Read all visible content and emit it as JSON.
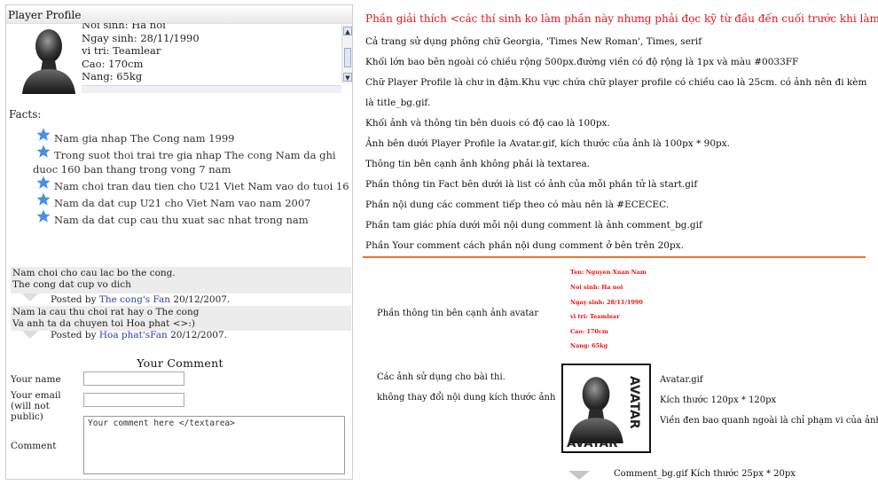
{
  "profile": {
    "title": "Player Profile",
    "info_lines": [
      "Noi sinh: Ha noi",
      "Ngay sinh: 28/11/1990",
      "vi tri: Teamlear",
      "Cao: 170cm",
      "Nang: 65kg"
    ]
  },
  "facts": {
    "label": "Facts:",
    "items": [
      "Nam gia nhap The Cong nam 1999",
      "Trong suot thoi trai tre gia nhap The cong Nam da ghi duoc 160 ban thang trong vong 7 nam",
      "Nam choi tran dau tien cho U21 Viet Nam vao do tuoi 16",
      "Nam da dat cup U21 cho Viet Nam vao nam 2007",
      "Nam da dat cup cau thu xuat sac nhat trong nam"
    ]
  },
  "comments": [
    {
      "lines": [
        "Nam choi cho cau lac bo the cong.",
        "The cong dat cup vo dich"
      ],
      "posted_by": "Posted by",
      "author": "The cong's Fan",
      "date": "20/12/2007."
    },
    {
      "lines": [
        "Nam la cau thu choi rat hay o The cong",
        "Va anh ta da chuyen toi Hoa phat <>:)"
      ],
      "posted_by": "Posted by",
      "author": "Hoa phat'sFan",
      "date": "20/12/2007."
    }
  ],
  "form": {
    "title": "Your Comment",
    "name_label": "Your name",
    "email_label": "Your email (will not public)",
    "comment_label": "Comment",
    "textarea_value": "Your comment here </textarea>"
  },
  "explain": {
    "heading": "Phần giải thích <các thí sinh ko làm phần này nhưng phải đọc kỹ từ đầu đến cuối trước khi làm bài>",
    "lines": [
      "Cả trang sử dụng phông chữ Georgia, 'Times New Roman', Times, serif",
      "Khối lớn bao bên ngoài có chiều rộng 500px.đường viền có độ rộng là 1px và màu #0033FF",
      "Chữ Player Profile là chư in đậm.Khu vực chứa chữ player profile có chiều cao là 25cm. có ảnh nên đi kèm",
      "là title_bg.gif.",
      "Khối ảnh và thông tin bên duois có độ cao là 100px.",
      "Ảnh bên dưới Player Profile la Avatar.gif, kích thước của ảnh là 100px * 90px.",
      "Thông tin bên cạnh ảnh không phải là textarea.",
      "Phần thông tin Fact bên dưới là list có ảnh của mỗi phần tử là start.gif",
      "Phần nội dung các comment tiếp theo có màu nên là #ECECEC.",
      "Phần tam giác phía dưới mỗi nội dung comment là ảnh comment_bg.gif",
      "Phần Your comment cách phần nội dung comment ở bên trên 20px."
    ],
    "sample_label": "Phần thông tin bên cạnh ảnh avatar",
    "sample_lines": [
      "Ten: Nguyen Xuan Nam",
      "Noi sinh: Ha noi",
      "Ngay sinh: 28/11/1990",
      "vi tri: Teamlear",
      "Cao: 170cm",
      "Nang: 65kg"
    ],
    "images_label": "Các ảnh sử dụng cho bài thi.",
    "images_note": "không thay đổi nội dung kích thước ảnh",
    "avatar_text": "AVATAR",
    "avatar_name": "Avatar.gif",
    "avatar_size": "Kích thước 120px * 120px",
    "avatar_border": "Viền đen bao quanh ngoài là chỉ phạm vi của ảnh",
    "comment_bg": "Comment_bg.gif Kích thước 25px * 20px"
  },
  "colors": {
    "star": "#4a90e2",
    "heading_red": "#e8141a",
    "rule": "#e8742c",
    "comment_bg": "#ececec",
    "link": "#2a44a8"
  }
}
